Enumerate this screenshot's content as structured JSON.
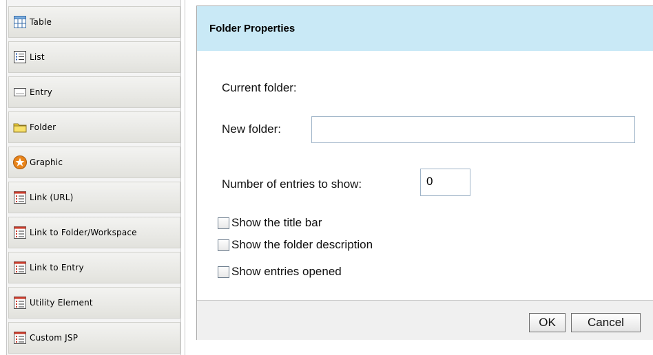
{
  "palette": {
    "items": [
      {
        "label": "Table",
        "icon": "table-icon"
      },
      {
        "label": "List",
        "icon": "list-icon"
      },
      {
        "label": "Entry",
        "icon": "entry-icon"
      },
      {
        "label": "Folder",
        "icon": "folder-icon"
      },
      {
        "label": "Graphic",
        "icon": "graphic-star-icon"
      },
      {
        "label": "Link (URL)",
        "icon": "link-url-icon"
      },
      {
        "label": "Link to Folder/Workspace",
        "icon": "link-folder-icon"
      },
      {
        "label": "Link to Entry",
        "icon": "link-entry-icon"
      },
      {
        "label": "Utility Element",
        "icon": "utility-element-icon"
      },
      {
        "label": "Custom JSP",
        "icon": "custom-jsp-icon"
      }
    ]
  },
  "dialog": {
    "title": "Folder Properties",
    "current_folder_label": "Current folder:",
    "new_folder_label": "New folder:",
    "new_folder_value": "",
    "entries_label": "Number of entries to show:",
    "entries_value": "0",
    "checkboxes": [
      {
        "label": "Show the title bar",
        "checked": false
      },
      {
        "label": "Show the folder description",
        "checked": false
      },
      {
        "label": "Show entries opened",
        "checked": false
      }
    ],
    "ok_label": "OK",
    "cancel_label": "Cancel"
  },
  "colors": {
    "header_bg": "#c9e9f6",
    "palette_item_bg": "#e8e8e4",
    "folder_yellow": "#f5d43a",
    "star_orange": "#e8841a",
    "list_red": "#c83a2a"
  }
}
